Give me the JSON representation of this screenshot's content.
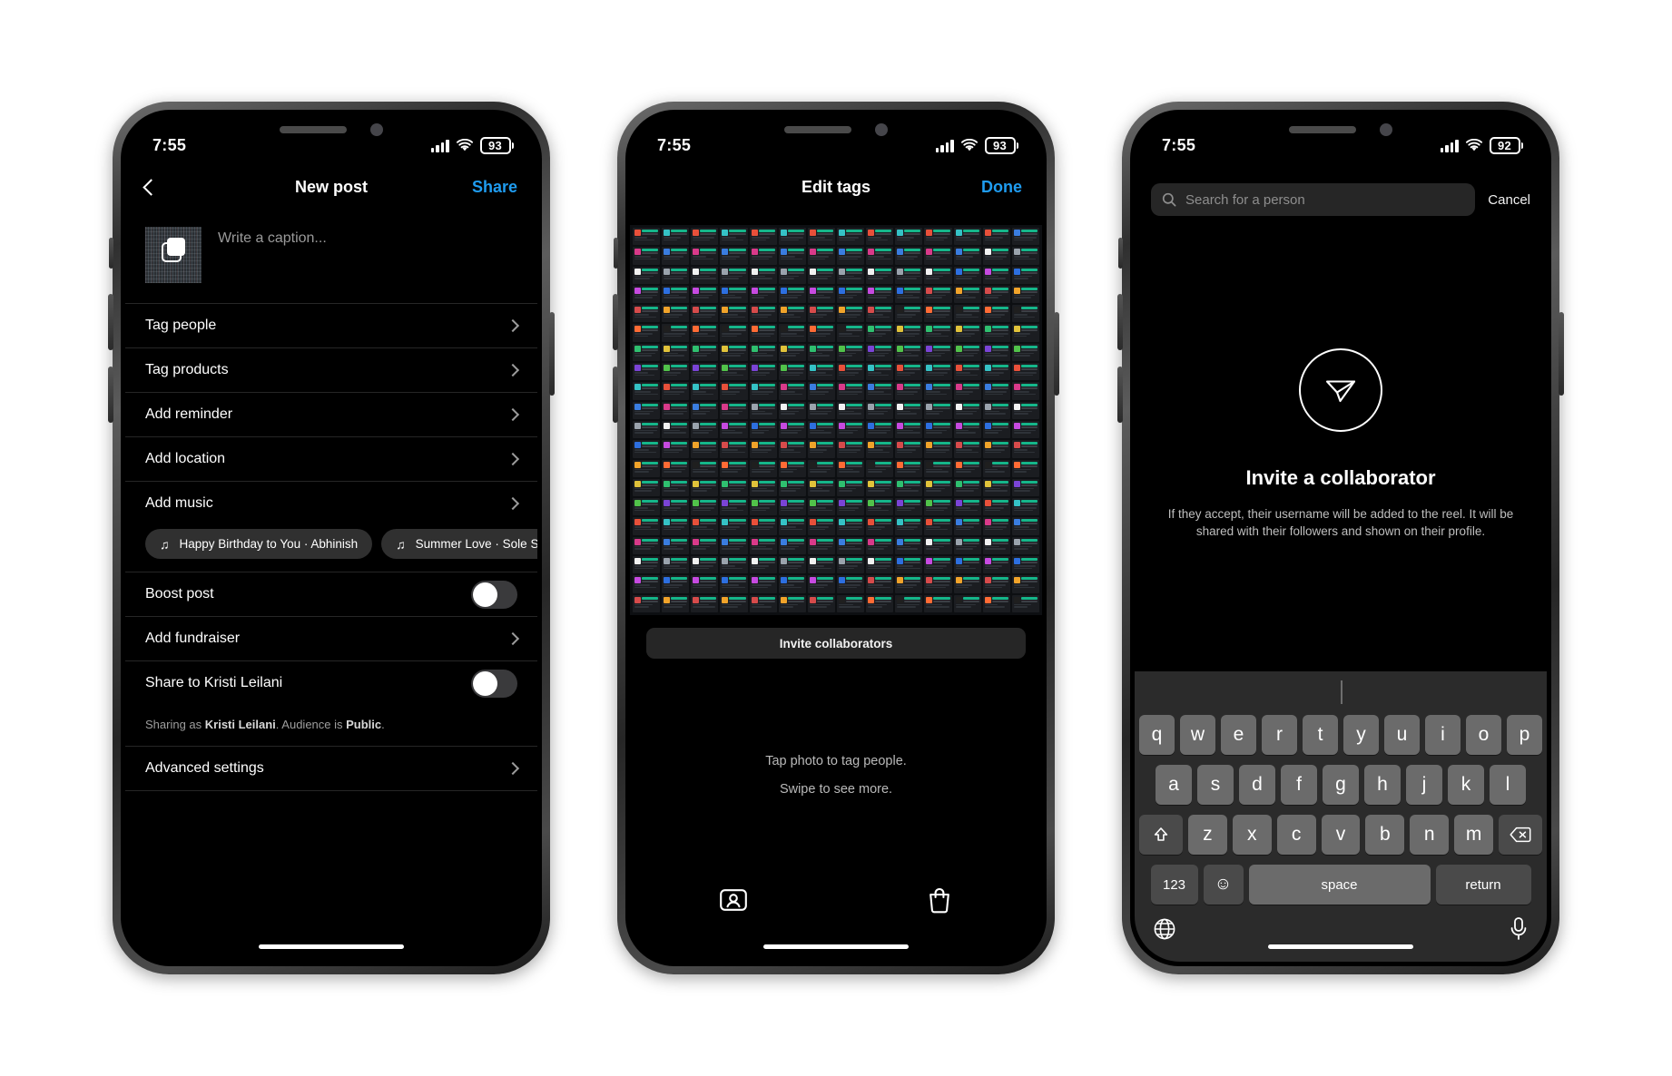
{
  "phones": [
    {
      "status": {
        "time": "7:55",
        "battery": "93"
      },
      "nav": {
        "title": "New post",
        "action": "Share",
        "back_icon": "back-chevron-icon"
      },
      "caption": {
        "placeholder": "Write a caption...",
        "thumb_icon": "multi-photo-icon"
      },
      "rows": [
        {
          "label": "Tag people",
          "accessory": "chevron"
        },
        {
          "label": "Tag products",
          "accessory": "chevron"
        },
        {
          "label": "Add reminder",
          "accessory": "chevron"
        },
        {
          "label": "Add location",
          "accessory": "chevron"
        },
        {
          "label": "Add music",
          "accessory": "chevron"
        },
        {
          "label": "Boost post",
          "accessory": "toggle"
        },
        {
          "label": "Add fundraiser",
          "accessory": "chevron"
        },
        {
          "label": "Share to Kristi Leilani",
          "accessory": "toggle"
        },
        {
          "label": "Advanced settings",
          "accessory": "chevron"
        }
      ],
      "music_chips": [
        {
          "icon": "music-note-icon",
          "label": "Happy Birthday to You · Abhinish"
        },
        {
          "icon": "music-note-icon",
          "label": "Summer Love · Sole Sole"
        }
      ],
      "sharing_note": {
        "prefix": "Sharing as ",
        "user": "Kristi Leilani",
        "middle": ". Audience is ",
        "audience": "Public",
        "suffix": "."
      }
    },
    {
      "status": {
        "time": "7:55",
        "battery": "93"
      },
      "nav": {
        "title": "Edit tags",
        "action": "Done"
      },
      "invite_button": "Invite collaborators",
      "hints": [
        "Tap photo to tag people.",
        "Swipe to see more."
      ],
      "tabs": [
        {
          "icon": "tag-person-icon",
          "name": "tag-people-tab"
        },
        {
          "icon": "shopping-bag-icon",
          "name": "tag-products-tab"
        }
      ]
    },
    {
      "status": {
        "time": "7:55",
        "battery": "92"
      },
      "search": {
        "placeholder": "Search for a person",
        "icon": "search-icon",
        "value": ""
      },
      "cancel": "Cancel",
      "collaborator": {
        "icon": "paper-plane-icon",
        "title": "Invite a collaborator",
        "description": "If they accept, their username will be added to the reel. It will be shared with their followers and shown on their profile."
      },
      "keyboard": {
        "row1": [
          "q",
          "w",
          "e",
          "r",
          "t",
          "y",
          "u",
          "i",
          "o",
          "p"
        ],
        "row2": [
          "a",
          "s",
          "d",
          "f",
          "g",
          "h",
          "j",
          "k",
          "l"
        ],
        "row3": [
          "z",
          "x",
          "c",
          "v",
          "b",
          "n",
          "m"
        ],
        "shift": "shift-icon",
        "backspace": "backspace-icon",
        "numbers": "123",
        "emoji": "emoji-icon",
        "space": "space",
        "return": "return",
        "globe": "globe-icon",
        "mic": "microphone-icon"
      }
    }
  ],
  "colors": {
    "accent": "#1f9cf0",
    "screen_bg": "#000000",
    "row_divider": "#262626",
    "key_bg": "#6b6b6b"
  }
}
